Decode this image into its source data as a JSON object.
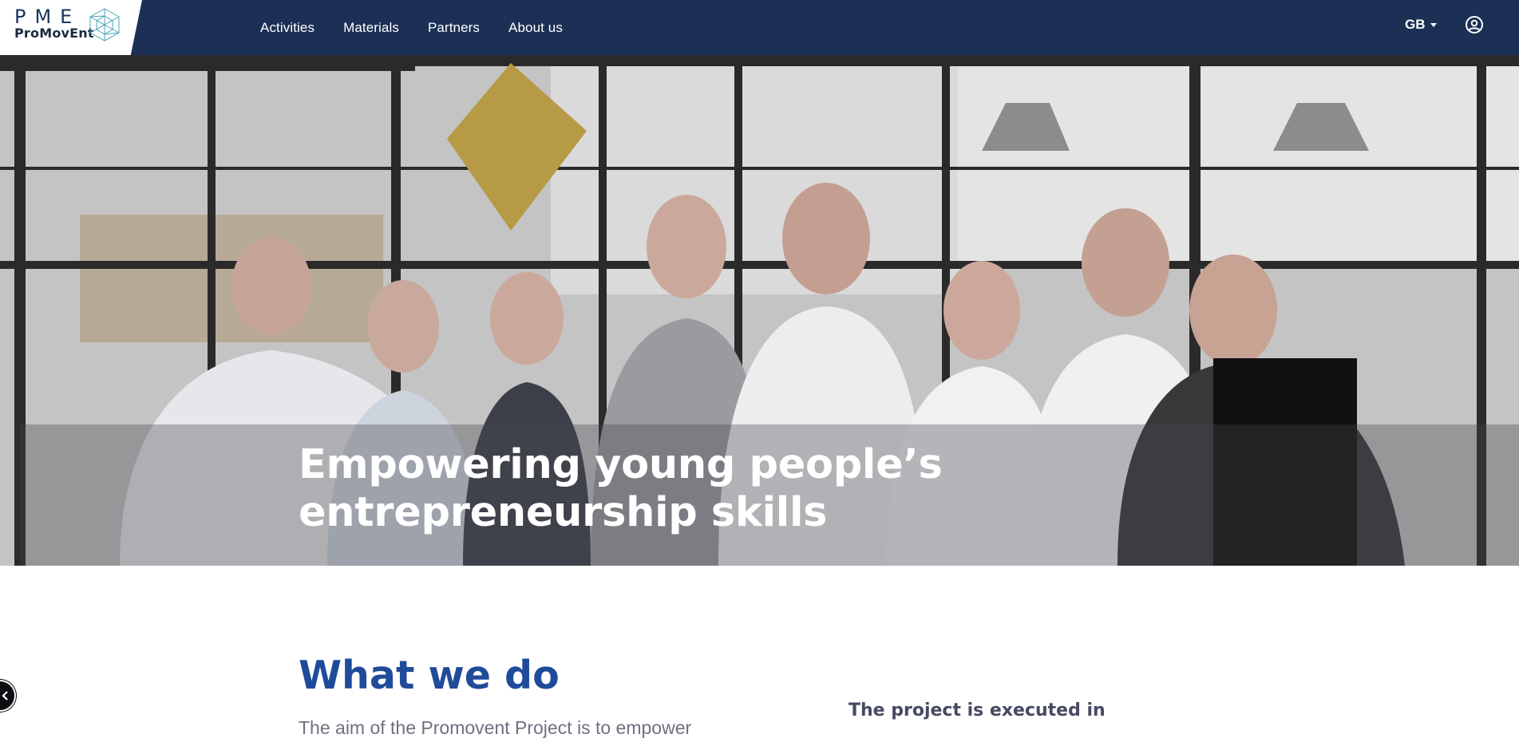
{
  "header": {
    "logo": {
      "letters": "PME",
      "wordmark": "ProMovEnt"
    },
    "nav": [
      {
        "label": "Activities"
      },
      {
        "label": "Materials"
      },
      {
        "label": "Partners"
      },
      {
        "label": "About us"
      }
    ],
    "language": "GB",
    "icons": {
      "language_caret": "chevron-down-icon",
      "account": "user-circle-icon"
    }
  },
  "hero": {
    "title_line1": "Empowering young people’s",
    "title_line2": "entrepreneurship skills"
  },
  "what_we_do": {
    "title": "What we do",
    "text": "The aim of the Promovent Project is to empower",
    "side_heading": "The project is executed in"
  },
  "floating_button": {
    "icon": "chevron-left-icon"
  },
  "colors": {
    "navbar": "#1b3054",
    "accent_heading": "#1f4b9a",
    "body_text": "#707080"
  }
}
